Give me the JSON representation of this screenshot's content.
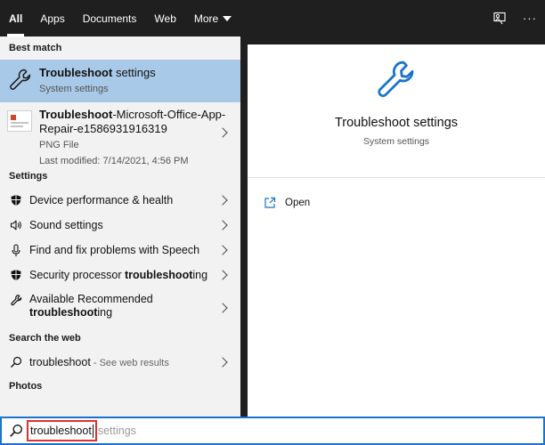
{
  "tabs": [
    {
      "label": "All",
      "active": true
    },
    {
      "label": "Apps",
      "active": false
    },
    {
      "label": "Documents",
      "active": false
    },
    {
      "label": "Web",
      "active": false
    },
    {
      "label": "More",
      "active": false
    }
  ],
  "topbar_right": {
    "feedback_icon": "feedback-icon",
    "more_icon": "···"
  },
  "best_match": {
    "header": "Best match",
    "title_bold": "Troubleshoot",
    "title_rest": " settings",
    "subtitle": "System settings",
    "icon": "wrench-icon"
  },
  "file_result": {
    "title_bold": "Troubleshoot",
    "title_rest": "-Microsoft-Office-App-Repair-e1586931916319",
    "type": "PNG File",
    "modified": "Last modified: 7/14/2021, 4:56 PM"
  },
  "settings_section": {
    "header": "Settings",
    "items": [
      {
        "icon": "shield-icon",
        "text": "Device performance & health"
      },
      {
        "icon": "speaker-icon",
        "text": "Sound settings"
      },
      {
        "icon": "microphone-icon",
        "text": "Find and fix problems with Speech"
      },
      {
        "icon": "shield-icon",
        "pre": "Security processor ",
        "bold": "troubleshoot",
        "post": "ing"
      },
      {
        "icon": "wrench-icon",
        "pre": "Available Recommended ",
        "bold": "troubleshoot",
        "post": "ing"
      }
    ]
  },
  "web_section": {
    "header": "Search the web",
    "query": "troubleshoot",
    "suffix": " - See web results"
  },
  "photos_section": {
    "header": "Photos"
  },
  "detail": {
    "title": "Troubleshoot settings",
    "subtitle": "System settings",
    "action_label": "Open",
    "icon": "wrench-icon"
  },
  "search": {
    "typed": "troubleshoot",
    "completion": "settings"
  },
  "colors": {
    "accent": "#1a73c9",
    "selection": "#a9c9e8",
    "highlight_border": "#e03030"
  }
}
